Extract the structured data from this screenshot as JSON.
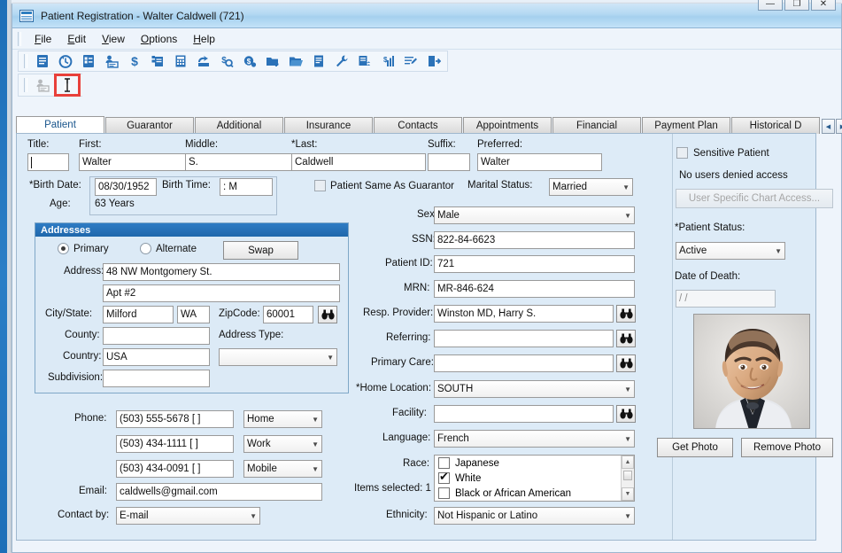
{
  "window": {
    "title": "Patient Registration - Walter Caldwell (721)",
    "title_icon": "form-window-icon",
    "buttons": {
      "minimize": "—",
      "maximize": "❐",
      "close": "✕"
    }
  },
  "menubar": [
    {
      "label": "File",
      "accel": "F"
    },
    {
      "label": "Edit",
      "accel": "E"
    },
    {
      "label": "View",
      "accel": "V"
    },
    {
      "label": "Options",
      "accel": "O"
    },
    {
      "label": "Help",
      "accel": "H"
    }
  ],
  "toolbar": {
    "icons": [
      "notes-icon",
      "clock-history-icon",
      "checklist-icon",
      "patient-card-icon",
      "dollar-icon",
      "invoice-icon",
      "calculator-icon",
      "claim-submit-icon",
      "charge-search-icon",
      "payment-icon",
      "folder-add-icon",
      "folder-open-icon",
      "document-icon",
      "wrench-icon",
      "ledger-icon",
      "financial-chart-icon",
      "edit-list-icon",
      "exit-door-icon"
    ]
  },
  "toolbar2": {
    "icons": [
      "patient-card-small-icon",
      "ibeam-cursor-icon"
    ],
    "highlighted_index": 1
  },
  "tabs": {
    "items": [
      "Patient",
      "Guarantor",
      "Additional",
      "Insurance",
      "Contacts",
      "Appointments",
      "Financial",
      "Payment Plan",
      "Historical D"
    ],
    "active": "Patient",
    "scroll_left": "◀",
    "scroll_right": "▶"
  },
  "name_section": {
    "title_label": "Title:",
    "title_value": "",
    "first_label": "First:",
    "first_value": "Walter",
    "middle_label": "Middle:",
    "middle_value": "S.",
    "last_label": "*Last:",
    "last_value": "Caldwell",
    "suffix_label": "Suffix:",
    "suffix_value": "",
    "preferred_label": "Preferred:",
    "preferred_value": "Walter"
  },
  "birth_section": {
    "birth_date_label": "*Birth Date:",
    "birth_date_value": "08/30/1952",
    "birth_time_label": "Birth Time:",
    "birth_time_value": ":    M",
    "age_label": "Age:",
    "age_value": "63 Years",
    "same_as_guarantor_label": "Patient Same As Guarantor",
    "same_as_guarantor_checked": false,
    "marital_status_label": "Marital Status:",
    "marital_status_value": "Married"
  },
  "addresses": {
    "group_title": "Addresses",
    "primary_label": "Primary",
    "primary_selected": true,
    "alternate_label": "Alternate",
    "alternate_selected": false,
    "swap_label": "Swap",
    "address_label": "Address:",
    "address_line1": "48 NW Montgomery St.",
    "address_line2": "Apt #2",
    "city_state_label": "City/State:",
    "city_value": "Milford",
    "state_value": "WA",
    "zip_label": "ZipCode:",
    "zip_value": "60001",
    "zip_lookup_icon": "binoculars-icon",
    "county_label": "County:",
    "county_value": "",
    "address_type_label": "Address Type:",
    "address_type_value": "",
    "country_label": "Country:",
    "country_value": "USA",
    "subdivision_label": "Subdivision:",
    "subdivision_value": ""
  },
  "contact": {
    "phone_label": "Phone:",
    "phones": [
      {
        "number": "(503) 555-5678 [    ]",
        "type": "Home"
      },
      {
        "number": "(503) 434-1111 [    ]",
        "type": "Work"
      },
      {
        "number": "(503) 434-0091 [    ]",
        "type": "Mobile"
      }
    ],
    "email_label": "Email:",
    "email_value": "caldwells@gmail.com",
    "contact_by_label": "Contact by:",
    "contact_by_value": "E-mail"
  },
  "demographics": {
    "sex_label": "Sex:",
    "sex_value": "Male",
    "ssn_label": "SSN:",
    "ssn_value": "822-84-6623",
    "patient_id_label": "Patient ID:",
    "patient_id_value": "721",
    "mrn_label": "MRN:",
    "mrn_value": "MR-846-624",
    "resp_provider_label": "Resp. Provider:",
    "resp_provider_value": "Winston MD, Harry S.",
    "referring_label": "Referring:",
    "referring_value": "",
    "primary_care_label": "Primary Care:",
    "primary_care_value": "",
    "home_location_label": "*Home Location:",
    "home_location_value": "SOUTH",
    "facility_label": "Facility:",
    "facility_value": "",
    "language_label": "Language:",
    "language_value": "French",
    "race_label": "Race:",
    "items_selected_label": "Items selected: 1",
    "race_options": [
      {
        "label": "Japanese",
        "checked": false
      },
      {
        "label": "White",
        "checked": true
      },
      {
        "label": "Black or African American",
        "checked": false
      }
    ],
    "ethnicity_label": "Ethnicity:",
    "ethnicity_value": "Not Hispanic or Latino",
    "lookup_icon": "binoculars-icon"
  },
  "sidepanel": {
    "sensitive_label": "Sensitive Patient",
    "sensitive_checked": false,
    "denied_access_text": "No users denied access",
    "chart_access_label": "User Specific Chart Access...",
    "chart_access_disabled": true,
    "patient_status_label": "*Patient Status:",
    "patient_status_value": "Active",
    "date_of_death_label": "Date of Death:",
    "date_of_death_value": "/  /",
    "photo_alt": "patient-photo",
    "get_photo_label": "Get Photo",
    "remove_photo_label": "Remove Photo"
  },
  "colors": {
    "panel_bg": "#ddebf7",
    "accent": "#1f67ab",
    "highlight": "#e8403a",
    "active_tab_text": "#19558c"
  }
}
